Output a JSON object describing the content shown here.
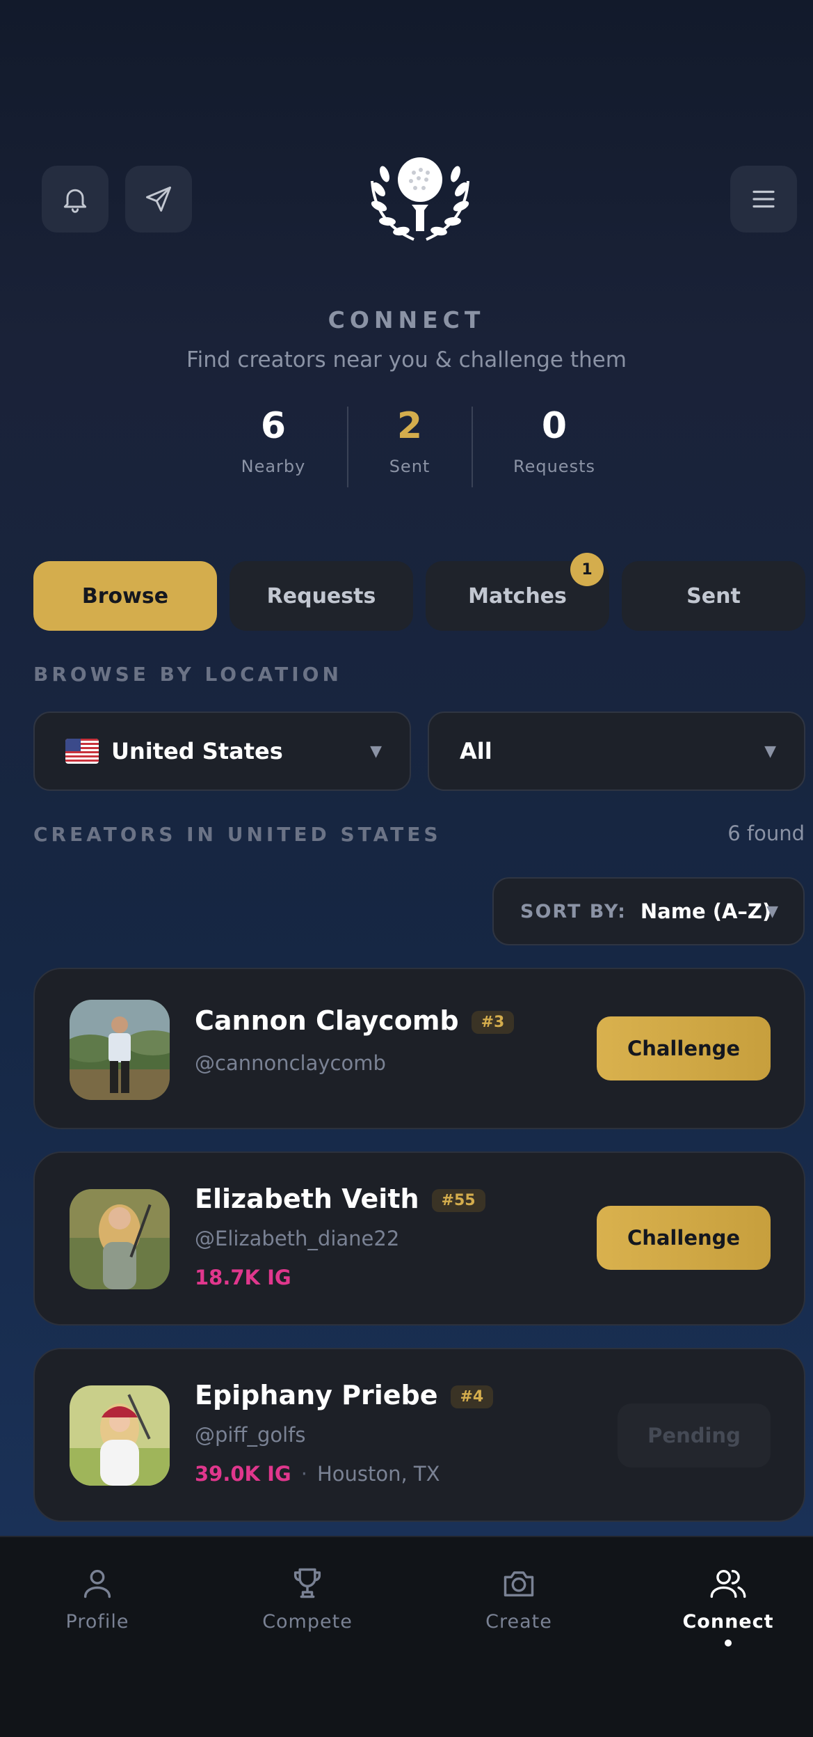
{
  "header": {
    "bell_icon": "bell-icon",
    "send_icon": "paper-plane-icon",
    "logo_icon": "golf-ball-laurel-logo",
    "menu_icon": "hamburger-menu-icon"
  },
  "hero": {
    "title": "CONNECT",
    "subtitle": "Find creators near you & challenge them"
  },
  "stats": [
    {
      "value": "6",
      "label": "Nearby"
    },
    {
      "value": "2",
      "label": "Sent"
    },
    {
      "value": "0",
      "label": "Requests"
    }
  ],
  "tabs": [
    {
      "label": "Browse",
      "active": true
    },
    {
      "label": "Requests"
    },
    {
      "label": "Matches",
      "badge": "1"
    },
    {
      "label": "Sent"
    }
  ],
  "browse": {
    "section_label": "BROWSE BY LOCATION",
    "country": "United States",
    "region": "All"
  },
  "creators": {
    "section_label": "CREATORS IN UNITED STATES",
    "found": "6 found",
    "sort_label": "SORT BY:",
    "sort_value": "Name (A–Z)",
    "items": [
      {
        "name": "Cannon Claycomb",
        "rank": "#3",
        "handle": "@cannonclaycomb",
        "action": "Challenge"
      },
      {
        "name": "Elizabeth Veith",
        "rank": "#55",
        "handle": "@Elizabeth_diane22",
        "ig": "18.7K IG",
        "action": "Challenge"
      },
      {
        "name": "Epiphany Priebe",
        "rank": "#4",
        "handle": "@piff_golfs",
        "ig": "39.0K IG",
        "separator": "·",
        "location": "Houston, TX",
        "action": "Pending"
      }
    ]
  },
  "nav": [
    {
      "label": "Profile",
      "icon": "person-icon"
    },
    {
      "label": "Compete",
      "icon": "trophy-icon"
    },
    {
      "label": "Create",
      "icon": "camera-icon"
    },
    {
      "label": "Connect",
      "icon": "people-icon",
      "active": true
    }
  ],
  "colors": {
    "accent": "#d4ad4d",
    "instagram": "#e0378d",
    "card": "#1d2027"
  }
}
